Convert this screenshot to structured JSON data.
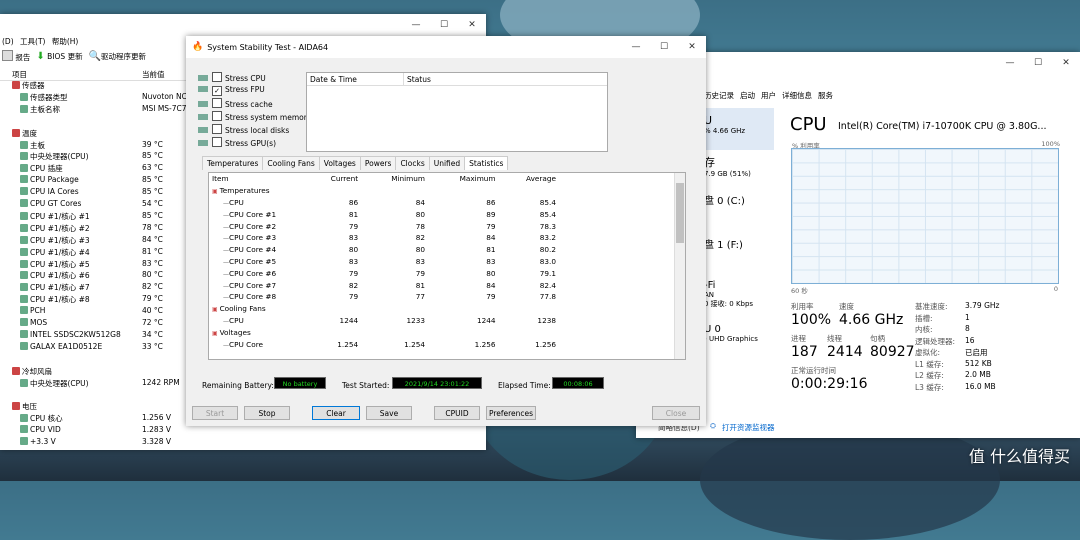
{
  "aida_main": {
    "menu": [
      "(D)",
      "工具(T)",
      "帮助(H)"
    ],
    "toolbar": [
      "报告",
      "BIOS 更新",
      "驱动程序更新"
    ],
    "col_item": "项目",
    "col_value": "当前值",
    "rows": [
      {
        "label": "传感器",
        "value": "",
        "indent": 0,
        "group": true
      },
      {
        "label": "传感器类型",
        "value": "Nuvoton NC",
        "indent": 1
      },
      {
        "label": "主板名称",
        "value": "MSI MS-7C7",
        "indent": 1
      },
      {
        "label": "",
        "value": "",
        "indent": 0
      },
      {
        "label": "温度",
        "value": "",
        "indent": 0,
        "group": true
      },
      {
        "label": "主板",
        "value": "39 °C",
        "indent": 1
      },
      {
        "label": "中央处理器(CPU)",
        "value": "85 °C",
        "indent": 1
      },
      {
        "label": "CPU 插座",
        "value": "63 °C",
        "indent": 1
      },
      {
        "label": "CPU Package",
        "value": "85 °C",
        "indent": 1
      },
      {
        "label": "CPU IA Cores",
        "value": "85 °C",
        "indent": 1
      },
      {
        "label": "CPU GT Cores",
        "value": "54 °C",
        "indent": 1
      },
      {
        "label": "CPU #1/核心 #1",
        "value": "85 °C",
        "indent": 1
      },
      {
        "label": "CPU #1/核心 #2",
        "value": "78 °C",
        "indent": 1
      },
      {
        "label": "CPU #1/核心 #3",
        "value": "84 °C",
        "indent": 1
      },
      {
        "label": "CPU #1/核心 #4",
        "value": "81 °C",
        "indent": 1
      },
      {
        "label": "CPU #1/核心 #5",
        "value": "83 °C",
        "indent": 1
      },
      {
        "label": "CPU #1/核心 #6",
        "value": "80 °C",
        "indent": 1
      },
      {
        "label": "CPU #1/核心 #7",
        "value": "82 °C",
        "indent": 1
      },
      {
        "label": "CPU #1/核心 #8",
        "value": "79 °C",
        "indent": 1
      },
      {
        "label": "PCH",
        "value": "40 °C",
        "indent": 1
      },
      {
        "label": "MOS",
        "value": "72 °C",
        "indent": 1
      },
      {
        "label": "INTEL SSDSC2KW512G8",
        "value": "34 °C",
        "indent": 1
      },
      {
        "label": "GALAX EA1D0512E",
        "value": "33 °C",
        "indent": 1
      },
      {
        "label": "",
        "value": "",
        "indent": 0
      },
      {
        "label": "冷却风扇",
        "value": "",
        "indent": 0,
        "group": true
      },
      {
        "label": "中央处理器(CPU)",
        "value": "1242 RPM",
        "indent": 1
      },
      {
        "label": "",
        "value": "",
        "indent": 0
      },
      {
        "label": "电压",
        "value": "",
        "indent": 0,
        "group": true
      },
      {
        "label": "CPU 核心",
        "value": "1.256 V",
        "indent": 1
      },
      {
        "label": "CPU VID",
        "value": "1.283 V",
        "indent": 1
      },
      {
        "label": "+3.3 V",
        "value": "3.328 V",
        "indent": 1
      }
    ]
  },
  "sst": {
    "title": "System Stability Test - AIDA64",
    "checks": [
      {
        "label": "Stress CPU",
        "checked": false
      },
      {
        "label": "Stress FPU",
        "checked": true
      },
      {
        "label": "Stress cache",
        "checked": false
      },
      {
        "label": "Stress system memory",
        "checked": false
      },
      {
        "label": "Stress local disks",
        "checked": false
      },
      {
        "label": "Stress GPU(s)",
        "checked": false
      }
    ],
    "log_cols": [
      "Date & Time",
      "Status"
    ],
    "tabs": [
      "Temperatures",
      "Cooling Fans",
      "Voltages",
      "Powers",
      "Clocks",
      "Unified",
      "Statistics"
    ],
    "active_tab": "Statistics",
    "stat_cols": [
      "Item",
      "Current",
      "Minimum",
      "Maximum",
      "Average"
    ],
    "stats": [
      {
        "item": "Temperatures",
        "group": true
      },
      {
        "item": "CPU",
        "cur": "86",
        "min": "84",
        "max": "86",
        "avg": "85.4"
      },
      {
        "item": "CPU Core #1",
        "cur": "81",
        "min": "80",
        "max": "89",
        "avg": "85.4"
      },
      {
        "item": "CPU Core #2",
        "cur": "79",
        "min": "78",
        "max": "79",
        "avg": "78.3"
      },
      {
        "item": "CPU Core #3",
        "cur": "83",
        "min": "82",
        "max": "84",
        "avg": "83.2"
      },
      {
        "item": "CPU Core #4",
        "cur": "80",
        "min": "80",
        "max": "81",
        "avg": "80.2"
      },
      {
        "item": "CPU Core #5",
        "cur": "83",
        "min": "83",
        "max": "83",
        "avg": "83.0"
      },
      {
        "item": "CPU Core #6",
        "cur": "79",
        "min": "79",
        "max": "80",
        "avg": "79.1"
      },
      {
        "item": "CPU Core #7",
        "cur": "82",
        "min": "81",
        "max": "84",
        "avg": "82.4"
      },
      {
        "item": "CPU Core #8",
        "cur": "79",
        "min": "77",
        "max": "79",
        "avg": "77.8"
      },
      {
        "item": "Cooling Fans",
        "group": true
      },
      {
        "item": "CPU",
        "cur": "1244",
        "min": "1233",
        "max": "1244",
        "avg": "1238"
      },
      {
        "item": "Voltages",
        "group": true
      },
      {
        "item": "CPU Core",
        "cur": "1.254",
        "min": "1.254",
        "max": "1.256",
        "avg": "1.256"
      }
    ],
    "remaining_battery_label": "Remaining Battery:",
    "remaining_battery": "No battery",
    "test_started_label": "Test Started:",
    "test_started": "2021/9/14 23:01:22",
    "elapsed_label": "Elapsed Time:",
    "elapsed": "00:08:06",
    "buttons": [
      "Start",
      "Stop",
      "Clear",
      "Save",
      "CPUID",
      "Preferences",
      "Close"
    ]
  },
  "taskmgr": {
    "menu": [
      "历史记录",
      "启动",
      "用户",
      "详细信息",
      "服务"
    ],
    "sidebar": [
      {
        "l1": "U",
        "l2": "% 4.66 GHz"
      },
      {
        "l1": "存",
        "l2": "7.9 GB (51%)"
      },
      {
        "l1": "盘 0 (C:)",
        "l2": ""
      },
      {
        "l1": "盘 1 (F:)",
        "l2": ""
      },
      {
        "l1": "-Fi",
        "l2": "AN\n0 接收: 0 Kbps"
      },
      {
        "l1": "U 0",
        "l2": ") UHD Graphics"
      }
    ],
    "title": "CPU",
    "cpu_name": "Intel(R) Core(TM) i7-10700K CPU @ 3.80G...",
    "graph_label": "% 利用率",
    "graph_max": "100%",
    "graph_left": "60 秒",
    "graph_right": "0",
    "util_label": "利用率",
    "util": "100%",
    "speed_label": "速度",
    "speed": "4.66 GHz",
    "proc_label": "进程",
    "proc": "187",
    "thread_label": "线程",
    "thread": "2414",
    "handle_label": "句柄",
    "handle": "80927",
    "uptime_label": "正常运行时间",
    "uptime": "0:00:29:16",
    "specs": [
      {
        "k": "基准速度:",
        "v": "3.79 GHz"
      },
      {
        "k": "插槽:",
        "v": "1"
      },
      {
        "k": "内核:",
        "v": "8"
      },
      {
        "k": "逻辑处理器:",
        "v": "16"
      },
      {
        "k": "虚拟化:",
        "v": "已启用"
      },
      {
        "k": "L1 缓存:",
        "v": "512 KB"
      },
      {
        "k": "L2 缓存:",
        "v": "2.0 MB"
      },
      {
        "k": "L3 缓存:",
        "v": "16.0 MB"
      }
    ],
    "footer_link": "打开资源监视器",
    "footer_prefix": "简略信息(D)"
  },
  "watermark": "值 什么值得买"
}
